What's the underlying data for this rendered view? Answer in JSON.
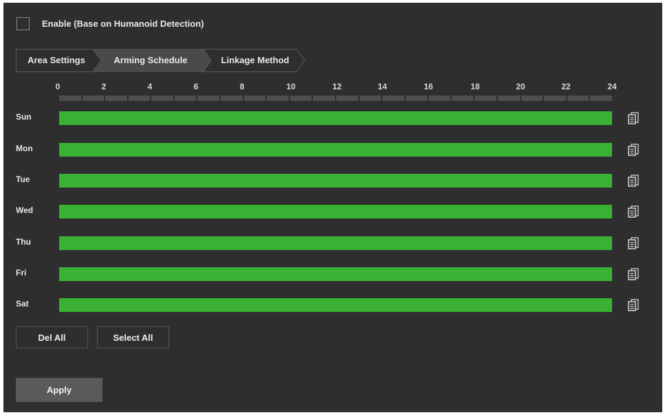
{
  "enable": {
    "label": "Enable (Base on Humanoid Detection)",
    "checked": false
  },
  "tabs": [
    {
      "label": "Area Settings",
      "active": false
    },
    {
      "label": "Arming Schedule",
      "active": true
    },
    {
      "label": "Linkage Method",
      "active": false
    }
  ],
  "hours": [
    "0",
    "2",
    "4",
    "6",
    "8",
    "10",
    "12",
    "14",
    "16",
    "18",
    "20",
    "22",
    "24"
  ],
  "days": [
    {
      "label": "Sun",
      "start": 0,
      "end": 24
    },
    {
      "label": "Mon",
      "start": 0,
      "end": 24
    },
    {
      "label": "Tue",
      "start": 0,
      "end": 24
    },
    {
      "label": "Wed",
      "start": 0,
      "end": 24
    },
    {
      "label": "Thu",
      "start": 0,
      "end": 24
    },
    {
      "label": "Fri",
      "start": 0,
      "end": 24
    },
    {
      "label": "Sat",
      "start": 0,
      "end": 24
    }
  ],
  "colors": {
    "schedule_bar": "#3ab135",
    "background": "#2e2e2e"
  },
  "icons": {
    "copy": "copy-icon"
  },
  "buttons": {
    "del_all": "Del All",
    "select_all": "Select All",
    "apply": "Apply"
  }
}
